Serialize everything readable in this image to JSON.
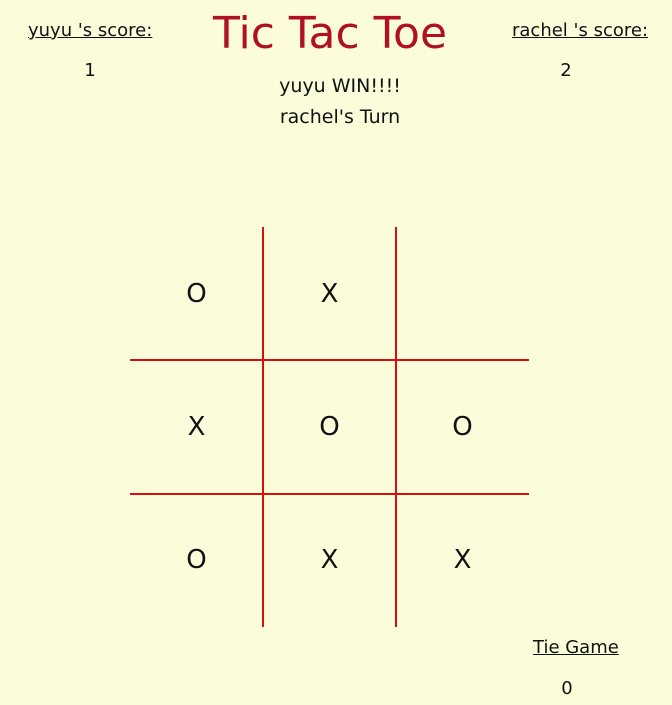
{
  "title": "Tic Tac Toe",
  "players": {
    "left": {
      "label": "yuyu 's score:",
      "score": "1"
    },
    "right": {
      "label": "rachel 's score:",
      "score": "2"
    }
  },
  "status": {
    "winner_message": "yuyu WIN!!!!",
    "turn_message": "rachel's Turn"
  },
  "board": {
    "cells": [
      "O",
      "X",
      "",
      "X",
      "O",
      "O",
      "O",
      "X",
      "X"
    ]
  },
  "tie": {
    "label": "Tie Game",
    "count": "0"
  },
  "colors": {
    "background": "#fafcda",
    "title": "#b01023",
    "grid_lines": "#d90f0f",
    "text": "#111111"
  }
}
